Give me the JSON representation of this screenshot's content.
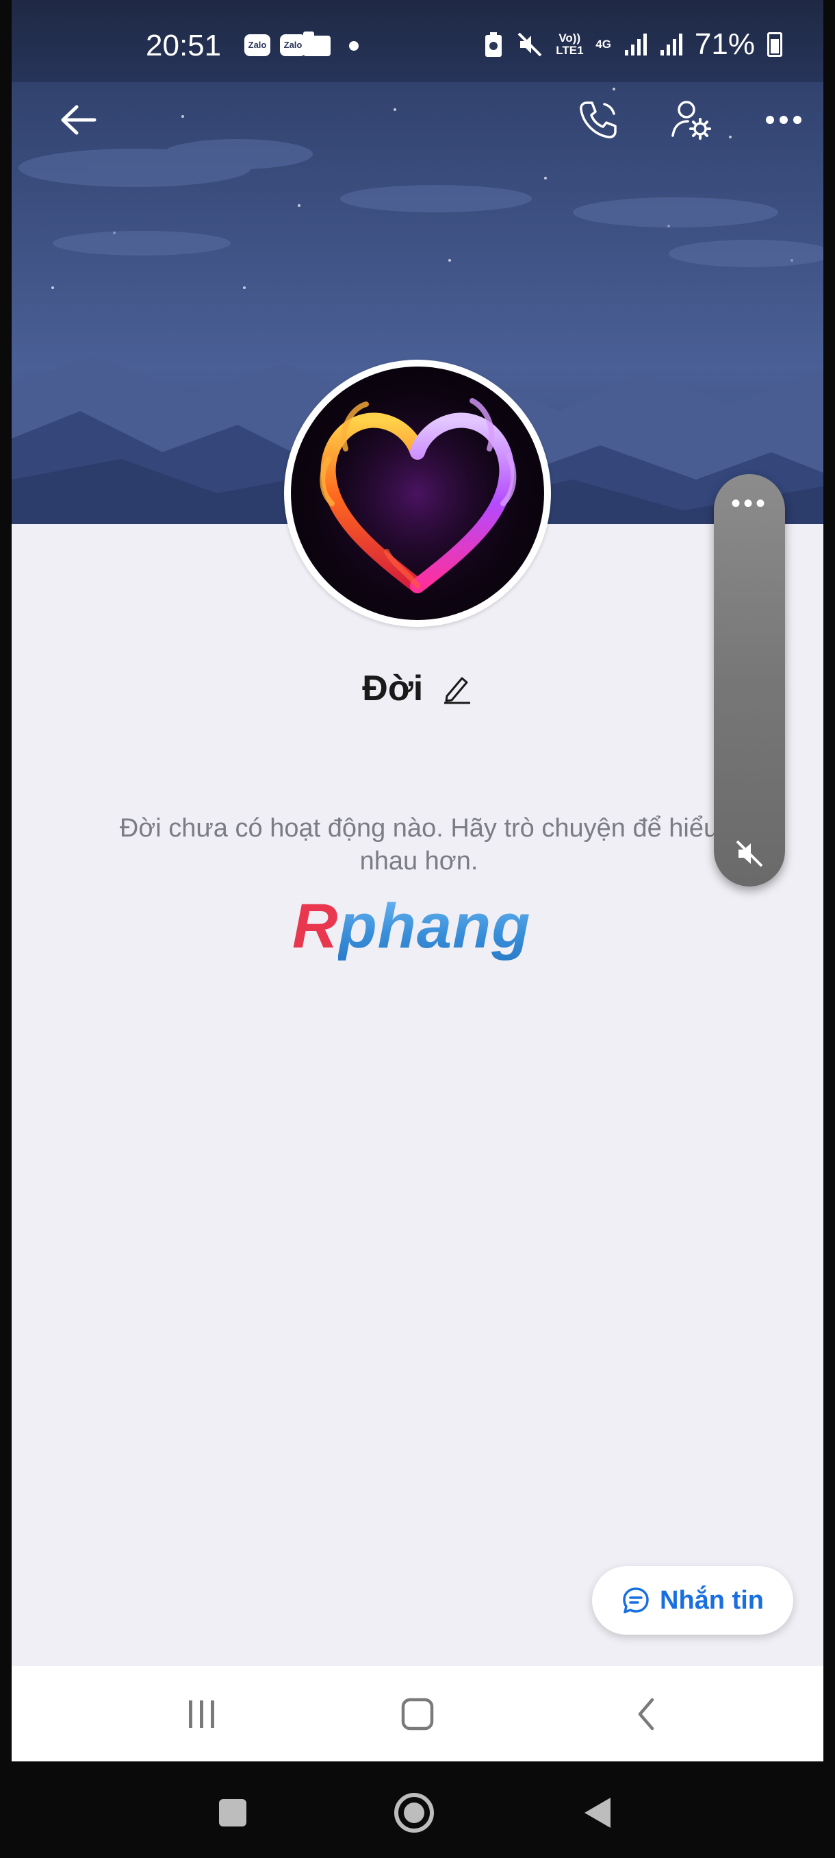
{
  "status_bar": {
    "time": "20:51",
    "notif_icons": [
      "Zalo",
      "Zalo"
    ],
    "network_1": "Vo)) LTE1",
    "network_2": "4G",
    "battery_percent": "71%"
  },
  "header": {
    "icons": [
      "back-arrow-icon",
      "phone-icon",
      "user-settings-icon",
      "more-icon"
    ]
  },
  "profile": {
    "name": "Đời",
    "empty_message": "Đời chưa có hoạt động nào. Hãy trò chuyện để hiểu nhau hơn."
  },
  "watermark": {
    "first": "R",
    "rest": "phang"
  },
  "floating_bubble": {
    "dots": "•••"
  },
  "message_button": {
    "label": "Nhắn tin"
  },
  "colors": {
    "accent": "#1a6fe0",
    "cover": "#3c4f80",
    "background": "#f0eff5"
  }
}
